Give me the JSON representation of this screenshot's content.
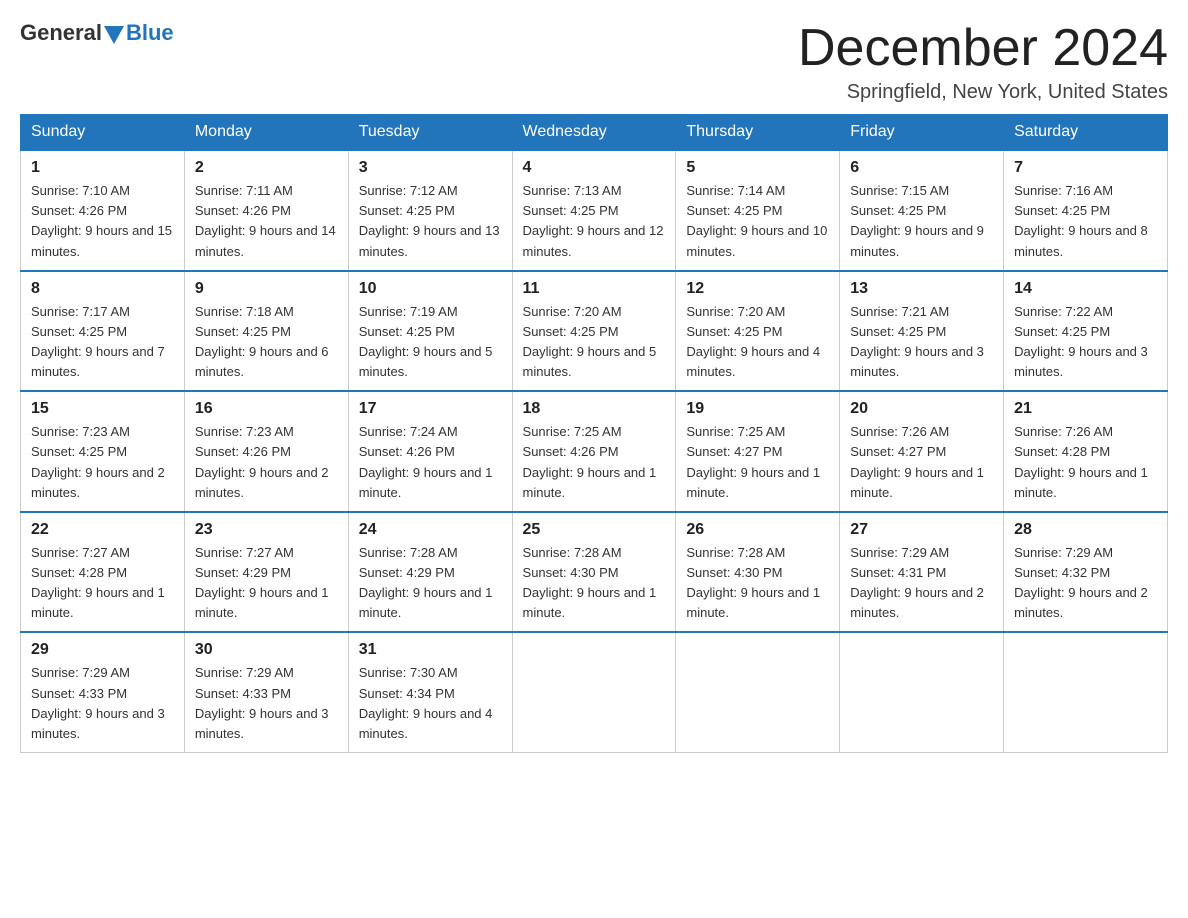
{
  "header": {
    "logo": {
      "general": "General",
      "blue": "Blue"
    },
    "title": "December 2024",
    "location": "Springfield, New York, United States"
  },
  "weekdays": [
    "Sunday",
    "Monday",
    "Tuesday",
    "Wednesday",
    "Thursday",
    "Friday",
    "Saturday"
  ],
  "weeks": [
    [
      {
        "day": "1",
        "sunrise": "7:10 AM",
        "sunset": "4:26 PM",
        "daylight": "9 hours and 15 minutes."
      },
      {
        "day": "2",
        "sunrise": "7:11 AM",
        "sunset": "4:26 PM",
        "daylight": "9 hours and 14 minutes."
      },
      {
        "day": "3",
        "sunrise": "7:12 AM",
        "sunset": "4:25 PM",
        "daylight": "9 hours and 13 minutes."
      },
      {
        "day": "4",
        "sunrise": "7:13 AM",
        "sunset": "4:25 PM",
        "daylight": "9 hours and 12 minutes."
      },
      {
        "day": "5",
        "sunrise": "7:14 AM",
        "sunset": "4:25 PM",
        "daylight": "9 hours and 10 minutes."
      },
      {
        "day": "6",
        "sunrise": "7:15 AM",
        "sunset": "4:25 PM",
        "daylight": "9 hours and 9 minutes."
      },
      {
        "day": "7",
        "sunrise": "7:16 AM",
        "sunset": "4:25 PM",
        "daylight": "9 hours and 8 minutes."
      }
    ],
    [
      {
        "day": "8",
        "sunrise": "7:17 AM",
        "sunset": "4:25 PM",
        "daylight": "9 hours and 7 minutes."
      },
      {
        "day": "9",
        "sunrise": "7:18 AM",
        "sunset": "4:25 PM",
        "daylight": "9 hours and 6 minutes."
      },
      {
        "day": "10",
        "sunrise": "7:19 AM",
        "sunset": "4:25 PM",
        "daylight": "9 hours and 5 minutes."
      },
      {
        "day": "11",
        "sunrise": "7:20 AM",
        "sunset": "4:25 PM",
        "daylight": "9 hours and 5 minutes."
      },
      {
        "day": "12",
        "sunrise": "7:20 AM",
        "sunset": "4:25 PM",
        "daylight": "9 hours and 4 minutes."
      },
      {
        "day": "13",
        "sunrise": "7:21 AM",
        "sunset": "4:25 PM",
        "daylight": "9 hours and 3 minutes."
      },
      {
        "day": "14",
        "sunrise": "7:22 AM",
        "sunset": "4:25 PM",
        "daylight": "9 hours and 3 minutes."
      }
    ],
    [
      {
        "day": "15",
        "sunrise": "7:23 AM",
        "sunset": "4:25 PM",
        "daylight": "9 hours and 2 minutes."
      },
      {
        "day": "16",
        "sunrise": "7:23 AM",
        "sunset": "4:26 PM",
        "daylight": "9 hours and 2 minutes."
      },
      {
        "day": "17",
        "sunrise": "7:24 AM",
        "sunset": "4:26 PM",
        "daylight": "9 hours and 1 minute."
      },
      {
        "day": "18",
        "sunrise": "7:25 AM",
        "sunset": "4:26 PM",
        "daylight": "9 hours and 1 minute."
      },
      {
        "day": "19",
        "sunrise": "7:25 AM",
        "sunset": "4:27 PM",
        "daylight": "9 hours and 1 minute."
      },
      {
        "day": "20",
        "sunrise": "7:26 AM",
        "sunset": "4:27 PM",
        "daylight": "9 hours and 1 minute."
      },
      {
        "day": "21",
        "sunrise": "7:26 AM",
        "sunset": "4:28 PM",
        "daylight": "9 hours and 1 minute."
      }
    ],
    [
      {
        "day": "22",
        "sunrise": "7:27 AM",
        "sunset": "4:28 PM",
        "daylight": "9 hours and 1 minute."
      },
      {
        "day": "23",
        "sunrise": "7:27 AM",
        "sunset": "4:29 PM",
        "daylight": "9 hours and 1 minute."
      },
      {
        "day": "24",
        "sunrise": "7:28 AM",
        "sunset": "4:29 PM",
        "daylight": "9 hours and 1 minute."
      },
      {
        "day": "25",
        "sunrise": "7:28 AM",
        "sunset": "4:30 PM",
        "daylight": "9 hours and 1 minute."
      },
      {
        "day": "26",
        "sunrise": "7:28 AM",
        "sunset": "4:30 PM",
        "daylight": "9 hours and 1 minute."
      },
      {
        "day": "27",
        "sunrise": "7:29 AM",
        "sunset": "4:31 PM",
        "daylight": "9 hours and 2 minutes."
      },
      {
        "day": "28",
        "sunrise": "7:29 AM",
        "sunset": "4:32 PM",
        "daylight": "9 hours and 2 minutes."
      }
    ],
    [
      {
        "day": "29",
        "sunrise": "7:29 AM",
        "sunset": "4:33 PM",
        "daylight": "9 hours and 3 minutes."
      },
      {
        "day": "30",
        "sunrise": "7:29 AM",
        "sunset": "4:33 PM",
        "daylight": "9 hours and 3 minutes."
      },
      {
        "day": "31",
        "sunrise": "7:30 AM",
        "sunset": "4:34 PM",
        "daylight": "9 hours and 4 minutes."
      },
      null,
      null,
      null,
      null
    ]
  ]
}
